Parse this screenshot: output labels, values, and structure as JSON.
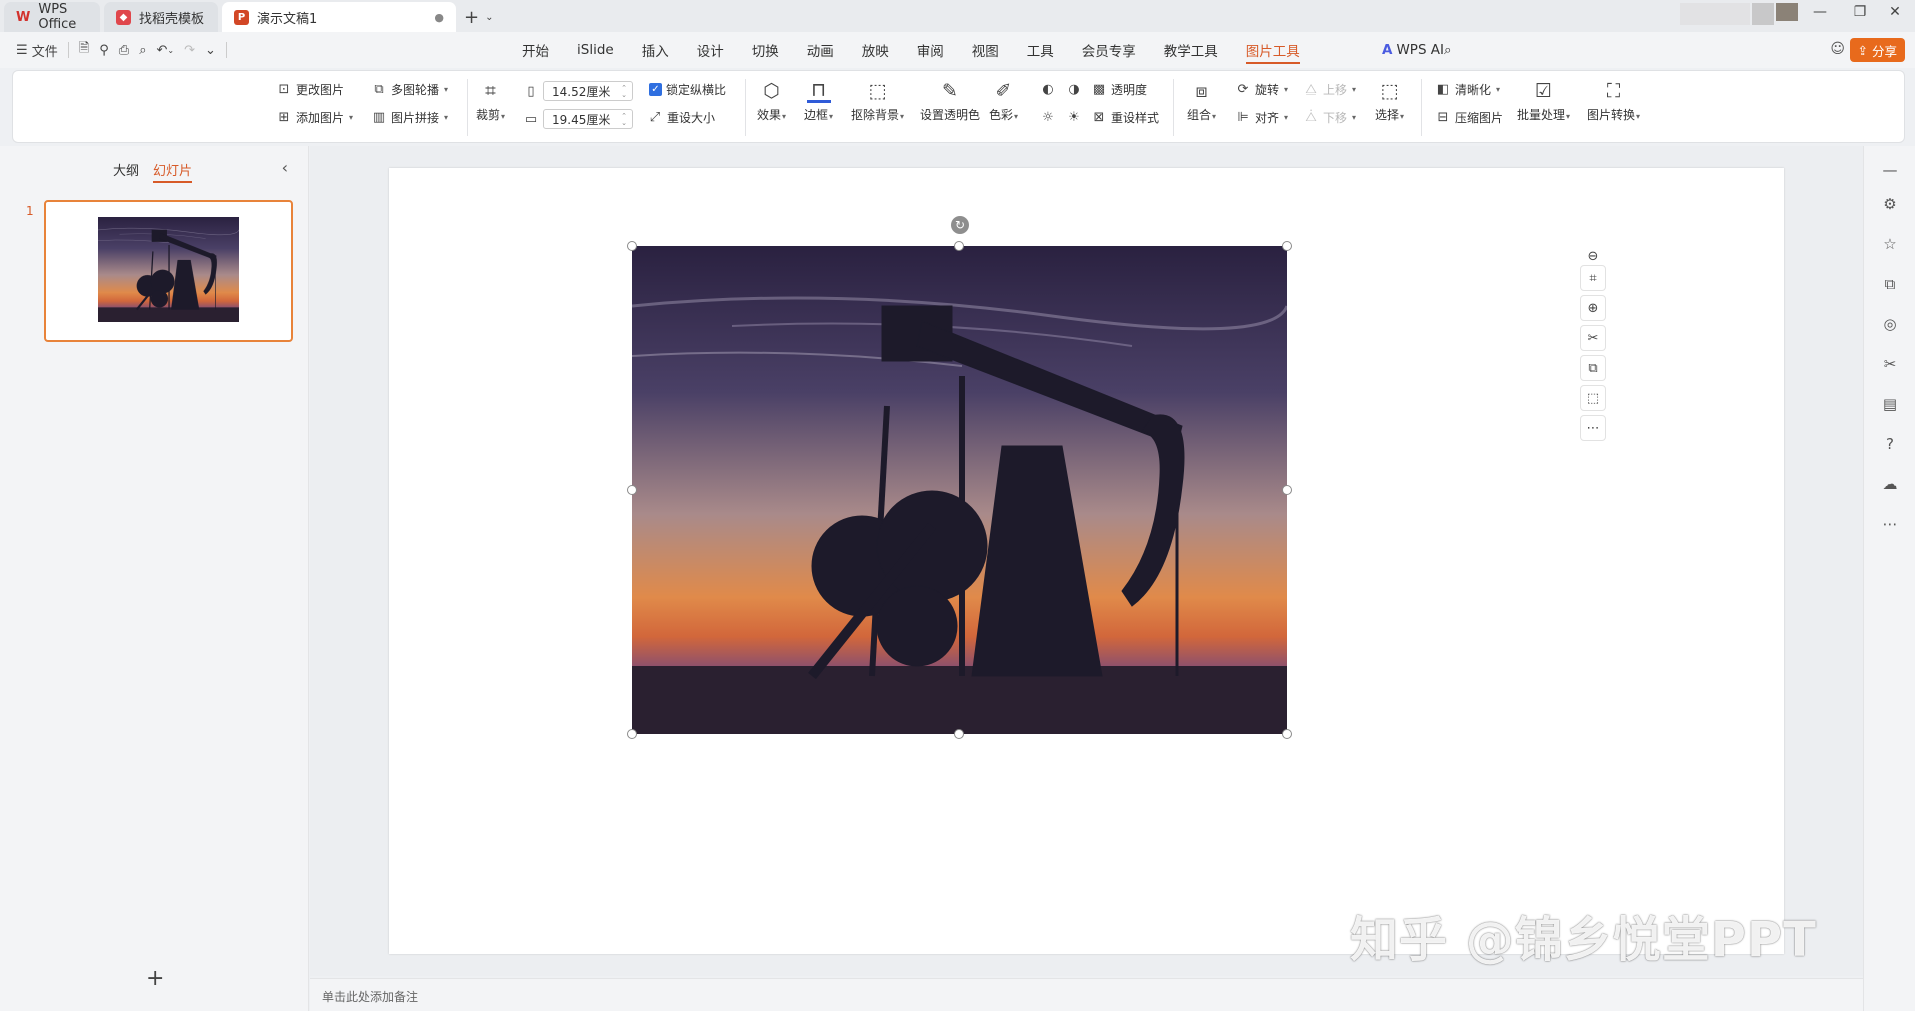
{
  "tabs": [
    {
      "label": "WPS Office"
    },
    {
      "label": "找稻壳模板"
    },
    {
      "label": "演示文稿1"
    }
  ],
  "menu": {
    "file": "文件",
    "tabs": [
      "开始",
      "iSlide",
      "插入",
      "设计",
      "切换",
      "动画",
      "放映",
      "审阅",
      "视图",
      "工具",
      "会员专享",
      "教学工具",
      "图片工具"
    ],
    "ai": "WPS AI",
    "share": "分享"
  },
  "ribbon": {
    "change_pic": "更改图片",
    "multi_carousel": "多图轮播",
    "add_pic": "添加图片",
    "pic_collage": "图片拼接",
    "crop": "裁剪",
    "width": "14.52厘米",
    "height": "19.45厘米",
    "lock_ratio": "锁定纵横比",
    "reset_size": "重设大小",
    "effects": "效果",
    "border": "边框",
    "remove_bg": "抠除背景",
    "set_transparent": "设置透明色",
    "color": "色彩",
    "transparency": "透明度",
    "reset_style": "重设样式",
    "group": "组合",
    "rotate": "旋转",
    "align": "对齐",
    "bring_up": "上移",
    "send_down": "下移",
    "select": "选择",
    "sharpen": "清晰化",
    "compress": "压缩图片",
    "batch": "批量处理",
    "convert": "图片转换"
  },
  "panel": {
    "outline": "大纲",
    "slides": "幻灯片",
    "slide_number": "1"
  },
  "notes_placeholder": "单击此处添加备注",
  "watermark": "知乎 @锦乡悦堂PPT",
  "colors": {
    "accent": "#d75a28",
    "share": "#e86a1c",
    "check": "#2f6fe0"
  }
}
